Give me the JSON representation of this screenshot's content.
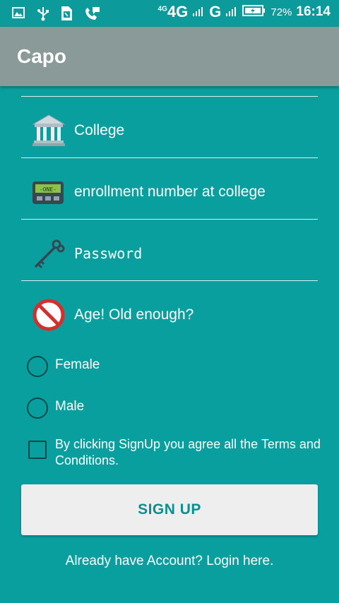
{
  "status_bar": {
    "network_small": "4G",
    "network": "4G",
    "network2": "G",
    "battery_percent": "72%",
    "time": "16:14",
    "icons": [
      "image-icon",
      "usb-icon",
      "sim-icon",
      "call-message-icon",
      "signal-icon",
      "battery-icon"
    ]
  },
  "app_bar": {
    "title": "Capo"
  },
  "form": {
    "college_placeholder": "College",
    "enrollment_placeholder": "enrollment number at college",
    "password_placeholder": "Password",
    "age_placeholder": "Age! Old enough?",
    "gender_options": [
      "Female",
      "Male"
    ],
    "terms_label": "By clicking SignUp you agree all the Terms and Conditions.",
    "signup_label": "SIGN UP",
    "login_link": "Already have Account? Login here."
  },
  "colors": {
    "background": "#0a9f9f",
    "app_bar": "#8a9a98",
    "button_bg": "#eeeeee",
    "button_text": "#0b8f8f"
  }
}
